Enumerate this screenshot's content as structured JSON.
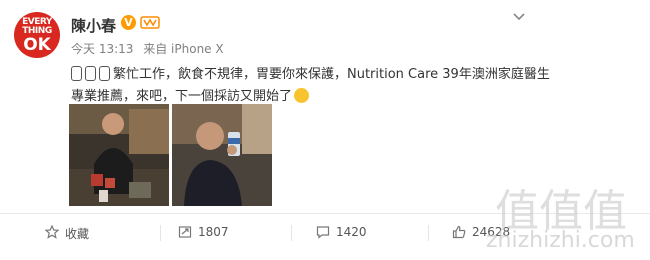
{
  "avatar": {
    "line1": "EVERY",
    "line2": "THING",
    "line3": "OK"
  },
  "user": {
    "name": "陳小春",
    "verified_badge": "V"
  },
  "meta": {
    "time": "今天 13:13",
    "source": "来自 iPhone X"
  },
  "post": {
    "text": "繁忙工作，飲食不規律，胃要你來保護，Nutrition Care 39年澳洲家庭醫生專業推薦，來吧，下一個採訪又開始了"
  },
  "photos": [
    {
      "description": "man-seated-at-table"
    },
    {
      "description": "man-holding-bottle-on-phone"
    }
  ],
  "actions": {
    "favorite_label": "收藏",
    "repost_count": "1807",
    "comment_count": "1420",
    "like_count": "24628"
  },
  "watermark": {
    "chars": "值值值",
    "domain": "zhizhizhi.com"
  },
  "colors": {
    "avatar_bg": "#d8281f",
    "vip_badge": "#ff9a00",
    "meta_text": "#808080"
  }
}
